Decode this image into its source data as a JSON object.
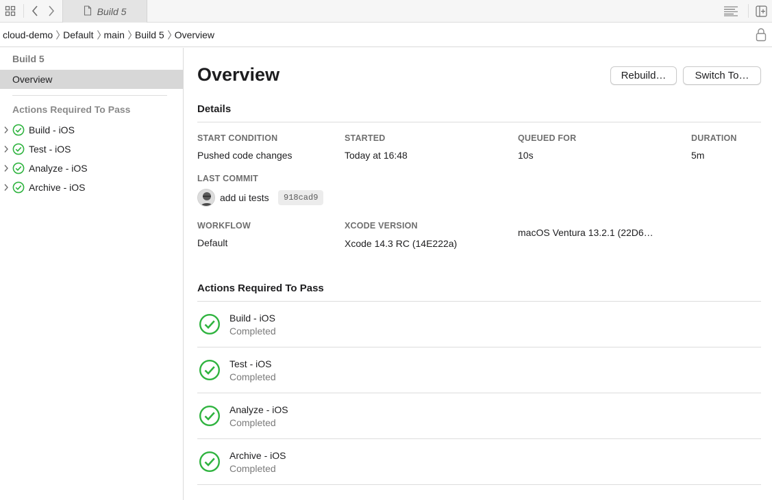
{
  "tab": {
    "label": "Build 5"
  },
  "breadcrumb": [
    "cloud-demo",
    "Default",
    "main",
    "Build 5",
    "Overview"
  ],
  "sidebar": {
    "title": "Build 5",
    "selected": "Overview",
    "section_title": "Actions Required To Pass",
    "items": [
      {
        "label": "Build - iOS"
      },
      {
        "label": "Test - iOS"
      },
      {
        "label": "Analyze - iOS"
      },
      {
        "label": "Archive - iOS"
      }
    ]
  },
  "main": {
    "title": "Overview",
    "rebuild_label": "Rebuild…",
    "switch_label": "Switch To…",
    "details": {
      "heading": "Details",
      "start_condition_label": "START CONDITION",
      "start_condition_value": "Pushed code changes",
      "started_label": "STARTED",
      "started_value": "Today at 16:48",
      "queued_label": "QUEUED FOR",
      "queued_value": "10s",
      "duration_label": "DURATION",
      "duration_value": "5m",
      "last_commit_label": "LAST COMMIT",
      "commit_message": "add ui tests",
      "commit_hash": "918cad9",
      "workflow_label": "WORKFLOW",
      "workflow_value": "Default",
      "xcode_label": "XCODE VERSION",
      "xcode_value": "Xcode 14.3 RC (14E222a)",
      "macos_value": "macOS Ventura 13.2.1 (22D6…"
    },
    "actions": {
      "heading": "Actions Required To Pass",
      "items": [
        {
          "name": "Build - iOS",
          "status": "Completed"
        },
        {
          "name": "Test - iOS",
          "status": "Completed"
        },
        {
          "name": "Analyze - iOS",
          "status": "Completed"
        },
        {
          "name": "Archive - iOS",
          "status": "Completed"
        }
      ]
    }
  },
  "colors": {
    "success": "#2fb33f",
    "selection": "#d7d7d7"
  }
}
